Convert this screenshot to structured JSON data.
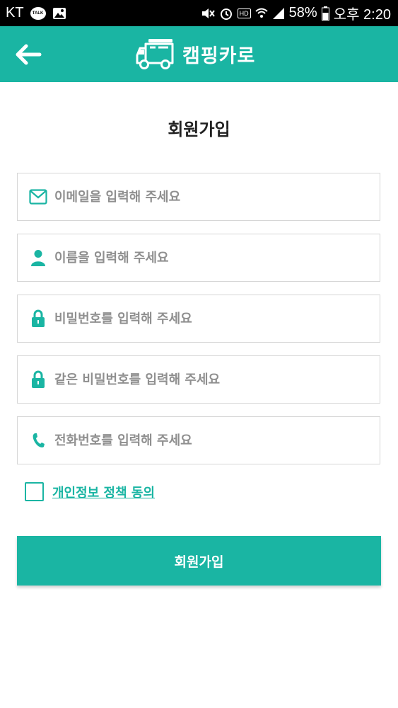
{
  "status_bar": {
    "carrier": "KT",
    "talk_badge": "TALK",
    "hd_badge": "HD",
    "battery": "58%",
    "time": "오후 2:20"
  },
  "header": {
    "title": "캠핑카로"
  },
  "form": {
    "title": "회원가입",
    "email_placeholder": "이메일을 입력해 주세요",
    "name_placeholder": "이름을 입력해 주세요",
    "password_placeholder": "비밀번호를 입력해 주세요",
    "password_confirm_placeholder": "같은 비밀번호를 입력해 주세요",
    "phone_placeholder": "전화번호를 입력해 주세요",
    "agree_label": "개인정보 정책 동의",
    "submit_label": "회원가입"
  },
  "colors": {
    "accent": "#1ab5a3",
    "background": "#ffffff",
    "placeholder": "#8f8f8f"
  }
}
